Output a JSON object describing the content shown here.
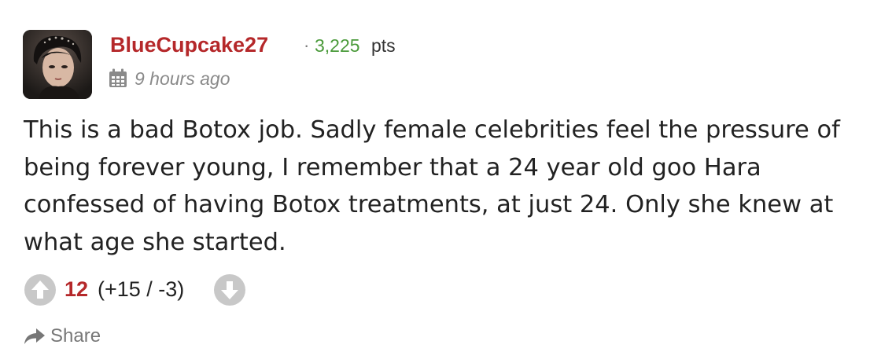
{
  "comment": {
    "username": "BlueCupcake27",
    "separator": "·",
    "points": "3,225",
    "points_label": "pts",
    "timestamp": "9 hours ago",
    "body": "This is a bad Botox job. Sadly female celebrities feel the pressure of being forever young, I remember that a 24 year old goo Hara confessed of having Botox treatments, at just 24. Only she knew at what age she started.",
    "votes": {
      "score": "12",
      "breakdown": "(+15 / -3)"
    },
    "share_label": "Share"
  },
  "colors": {
    "username": "#b5282a",
    "points": "#4a9a3a",
    "score": "#b5282a",
    "vote_button": "#c8c8c8",
    "muted": "#777777"
  },
  "icons": {
    "calendar": "calendar-icon",
    "upvote": "arrow-up-circle-icon",
    "downvote": "arrow-down-circle-icon",
    "share": "share-arrow-icon"
  }
}
